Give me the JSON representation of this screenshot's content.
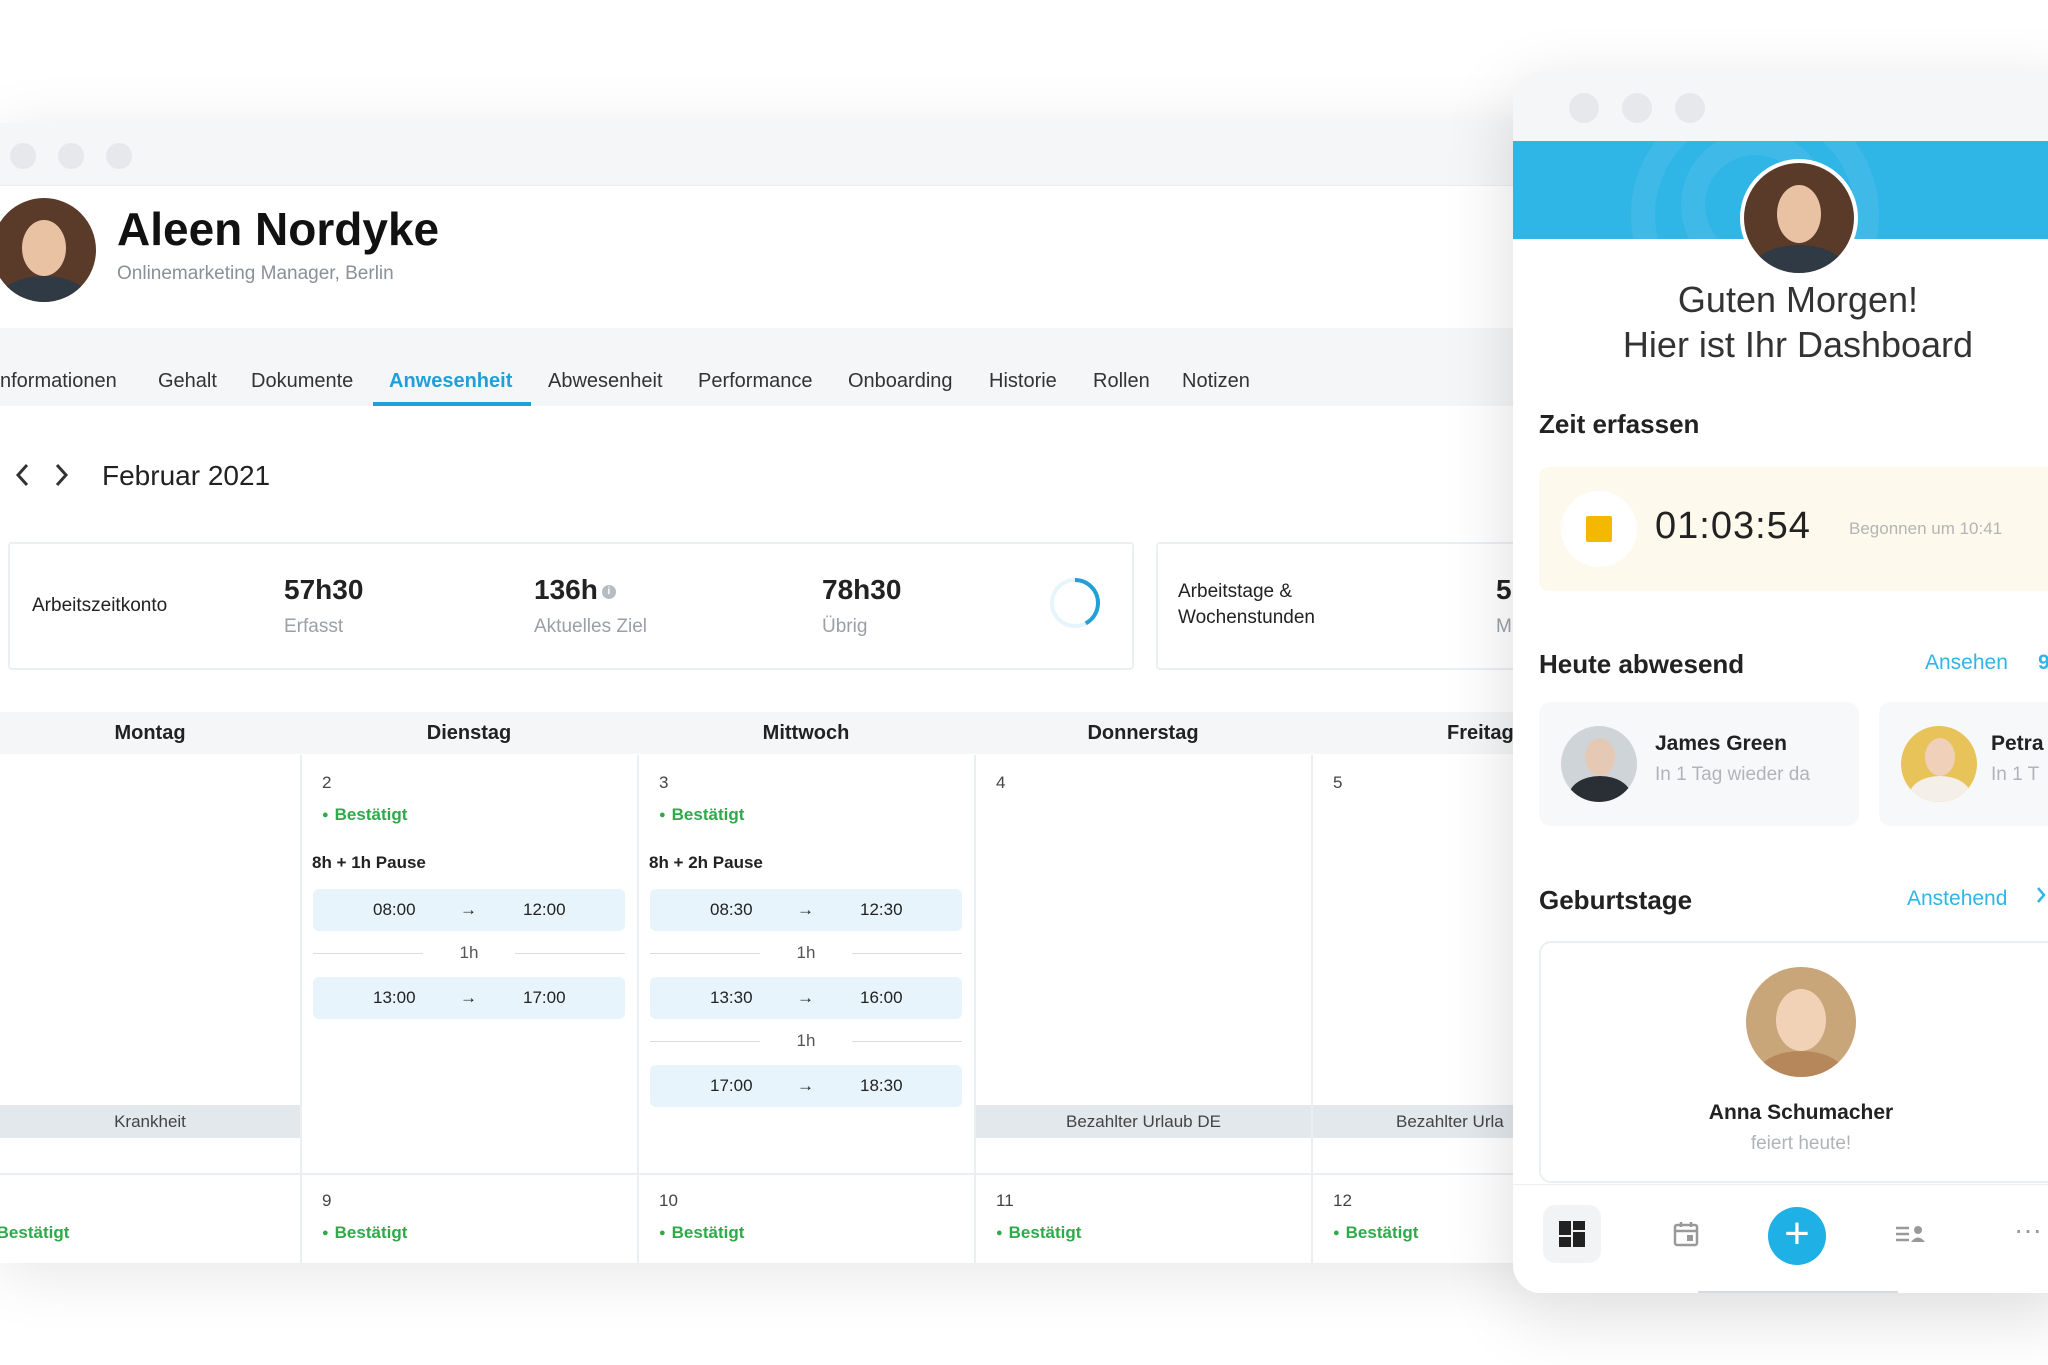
{
  "profile": {
    "name": "Aleen Nordyke",
    "role": "Onlinemarketing Manager, Berlin"
  },
  "tabs": [
    {
      "label": "nformationen"
    },
    {
      "label": "Gehalt"
    },
    {
      "label": "Dokumente"
    },
    {
      "label": "Anwesenheit",
      "active": true
    },
    {
      "label": "Abwesenheit"
    },
    {
      "label": "Performance"
    },
    {
      "label": "Onboarding"
    },
    {
      "label": "Historie"
    },
    {
      "label": "Rollen"
    },
    {
      "label": "Notizen"
    }
  ],
  "calendar_nav": {
    "month": "Februar 2021",
    "prev_icon": "chevron-left-icon",
    "next_icon": "chevron-right-icon"
  },
  "stats": {
    "account_label": "Arbeitszeitkonto",
    "recorded_value": "57h30",
    "recorded_label": "Erfasst",
    "target_value": "136h",
    "target_label": "Aktuelles Ziel",
    "target_info": "i",
    "remaining_value": "78h30",
    "remaining_label": "Übrig",
    "workdays_label_1": "Arbeitstage &",
    "workdays_label_2": "Wochenstunden",
    "workdays_value": "5",
    "workdays_sub": "M"
  },
  "days": [
    "Montag",
    "Dienstag",
    "Mittwoch",
    "Donnerstag",
    "Freitag"
  ],
  "week1": {
    "tue": {
      "num": "2",
      "status": "Bestätigt",
      "pause": "8h + 1h Pause",
      "slots": [
        {
          "from": "08:00",
          "to": "12:00"
        },
        {
          "from": "13:00",
          "to": "17:00"
        }
      ],
      "gaps": [
        "1h"
      ]
    },
    "wed": {
      "num": "3",
      "status": "Bestätigt",
      "pause": "8h + 2h Pause",
      "slots": [
        {
          "from": "08:30",
          "to": "12:30"
        },
        {
          "from": "13:30",
          "to": "16:00"
        },
        {
          "from": "17:00",
          "to": "18:30"
        }
      ],
      "gaps": [
        "1h",
        "1h"
      ]
    },
    "thu": {
      "num": "4"
    },
    "fri": {
      "num": "5"
    },
    "arrow": "→",
    "absences": {
      "mon": "Krankheit",
      "thu": "Bezahlter Urlaub DE",
      "fri": "Bezahlter Urla"
    }
  },
  "week2": {
    "mon": {
      "status": "Bestätigt"
    },
    "tue": {
      "num": "9",
      "status": "Bestätigt"
    },
    "wed": {
      "num": "10",
      "status": "Bestätigt"
    },
    "thu": {
      "num": "11",
      "status": "Bestätigt"
    },
    "fri": {
      "num": "12",
      "status": "Bestätigt"
    }
  },
  "mobile": {
    "greeting_1": "Guten Morgen!",
    "greeting_2": "Hier ist Ihr Dashboard",
    "time_section": "Zeit erfassen",
    "timer": "01:03:54",
    "timer_started": "Begonnen um 10:41",
    "absent_section": "Heute abwesend",
    "absent_link": "Ansehen",
    "absent_count": "9",
    "absent_people": [
      {
        "name": "James Green",
        "sub": "In 1 Tag wieder da"
      },
      {
        "name": "Petra",
        "sub": "In 1 T"
      }
    ],
    "birthday_section": "Geburtstage",
    "birthday_link": "Anstehend",
    "birthday_person": {
      "name": "Anna Schumacher",
      "sub": "feiert heute!"
    },
    "fab": "+",
    "more": "···",
    "colors": {
      "accent": "#2fb5e6",
      "confirmed": "#2eaa4a",
      "stop": "#f5b800"
    }
  }
}
